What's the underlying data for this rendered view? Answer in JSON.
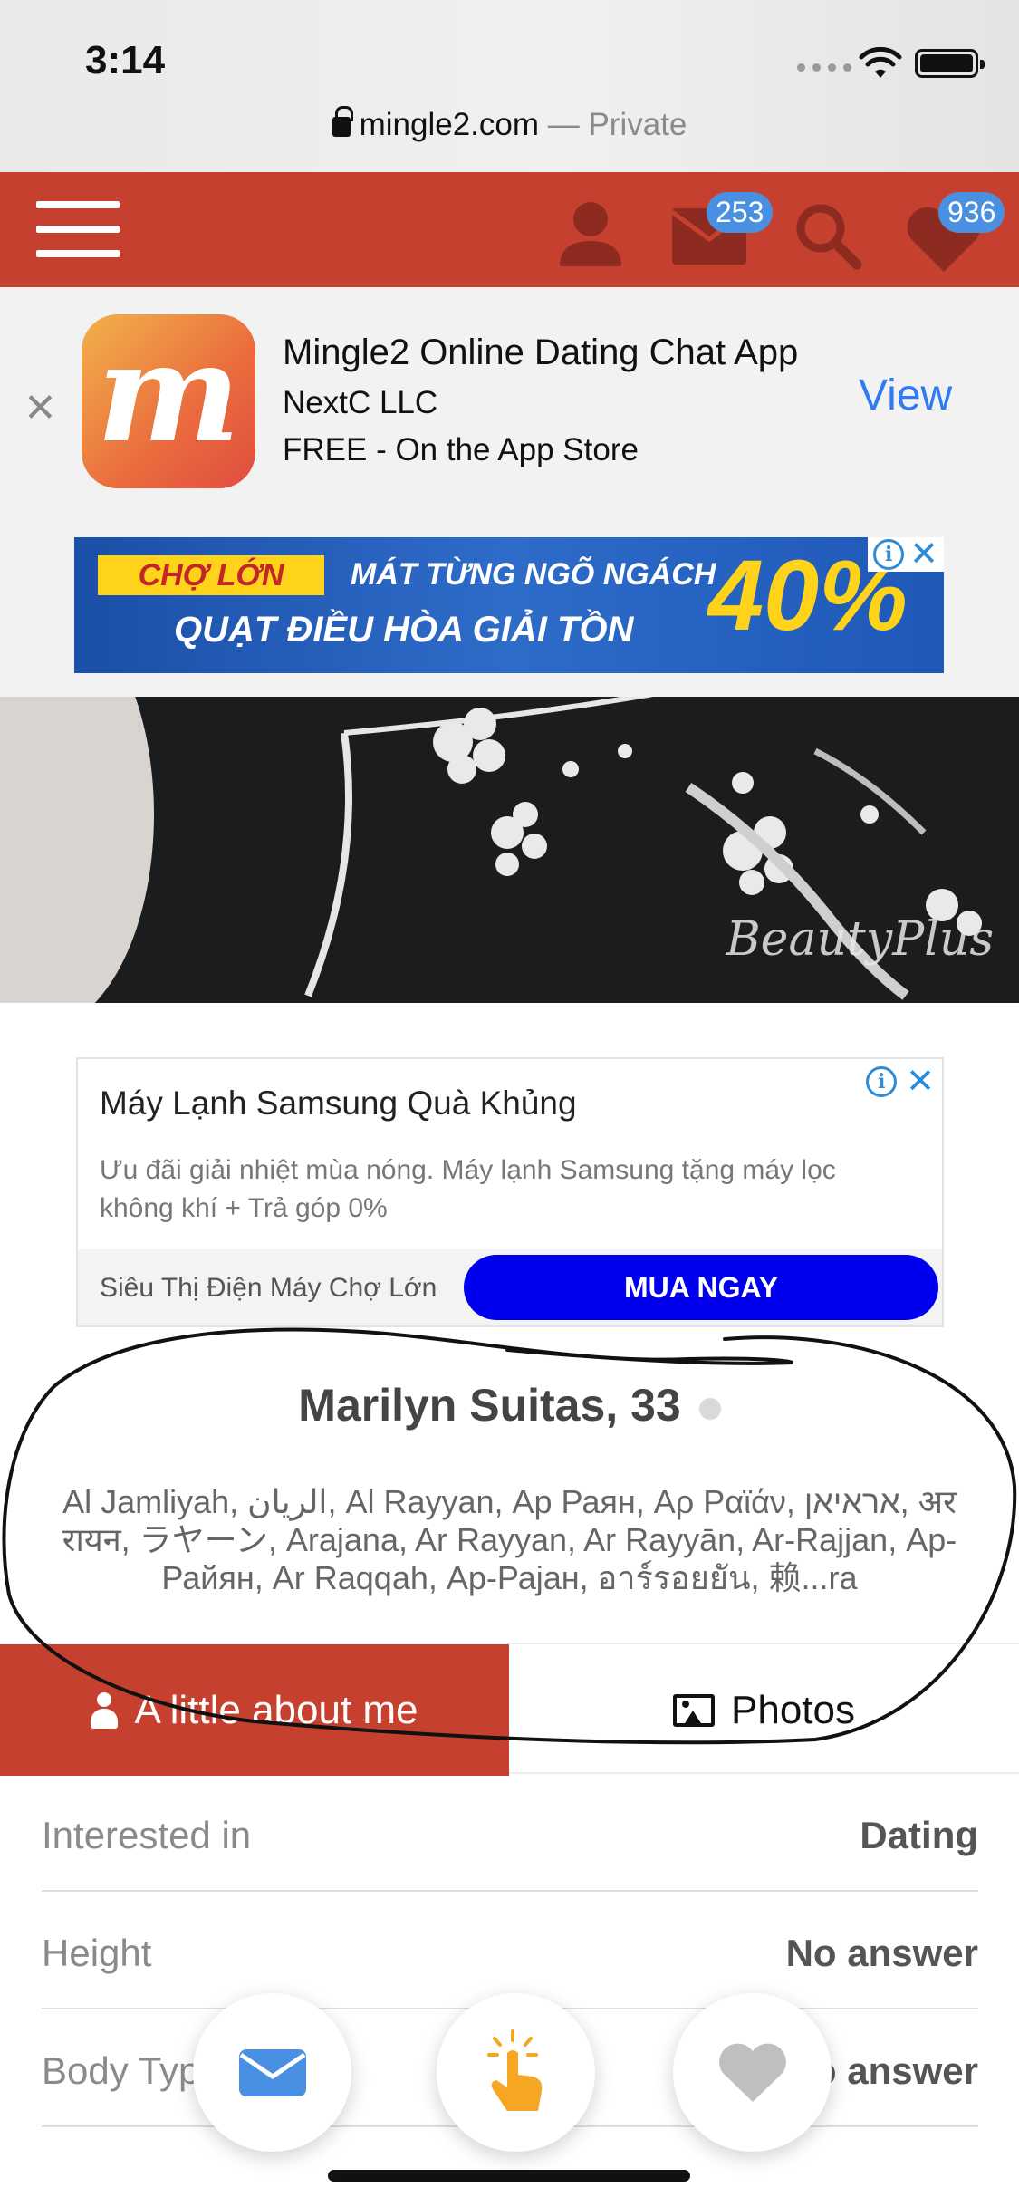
{
  "status_bar": {
    "time": "3:14"
  },
  "browser": {
    "domain": "mingle2.com",
    "private_label": " — Private"
  },
  "header": {
    "messages_count": "253",
    "likes_count": "936"
  },
  "app_banner": {
    "name": "Mingle2 Online Dating Chat App",
    "developer": "NextC LLC",
    "price": "FREE - On the App Store",
    "view_label": "View",
    "icon_letter": "m"
  },
  "ad_top": {
    "store": "CHỢ LỚN",
    "line1": "MÁT TỪNG NGÕ NGÁCH",
    "line2": "QUẠT ĐIỀU HÒA GIẢI TỒN",
    "sale": "40%"
  },
  "photo": {
    "watermark": "BeautyPlus"
  },
  "ad_text": {
    "title": "Máy Lạnh Samsung Quà Khủng",
    "description": "Ưu đãi giải nhiệt mùa nóng. Máy lạnh Samsung tặng máy lọc không khí + Trả góp 0%",
    "store": "Siêu Thị Điện Máy Chợ Lớn",
    "cta": "MUA NGAY"
  },
  "profile": {
    "name_age": "Marilyn Suitas, 33",
    "location_line1": "Al Jamliyah, الريان, Al Rayyan, Ар Раян, Αρ Ραϊάν, אראיאן, अर",
    "location_line2": "रायन, ラヤーン, Arajana, Ar Rayyan, Ar Rayyān, Ar-Rajjan, Ар-",
    "location_line3": "Райян, Ar Raqqah, Ар-Раjан, อาร์รอยยัน, 赖...ra"
  },
  "tabs": {
    "about": "A little about me",
    "photos": "Photos"
  },
  "details": [
    {
      "label": "Interested in",
      "value": "Dating"
    },
    {
      "label": "Height",
      "value": "No answer"
    },
    {
      "label": "Body Type",
      "value": "No answer"
    }
  ],
  "colors": {
    "brand_red": "#c5402f",
    "badge_blue": "#4a90e2",
    "link_blue": "#2f7bf4",
    "cta_blue": "#0000ee"
  }
}
